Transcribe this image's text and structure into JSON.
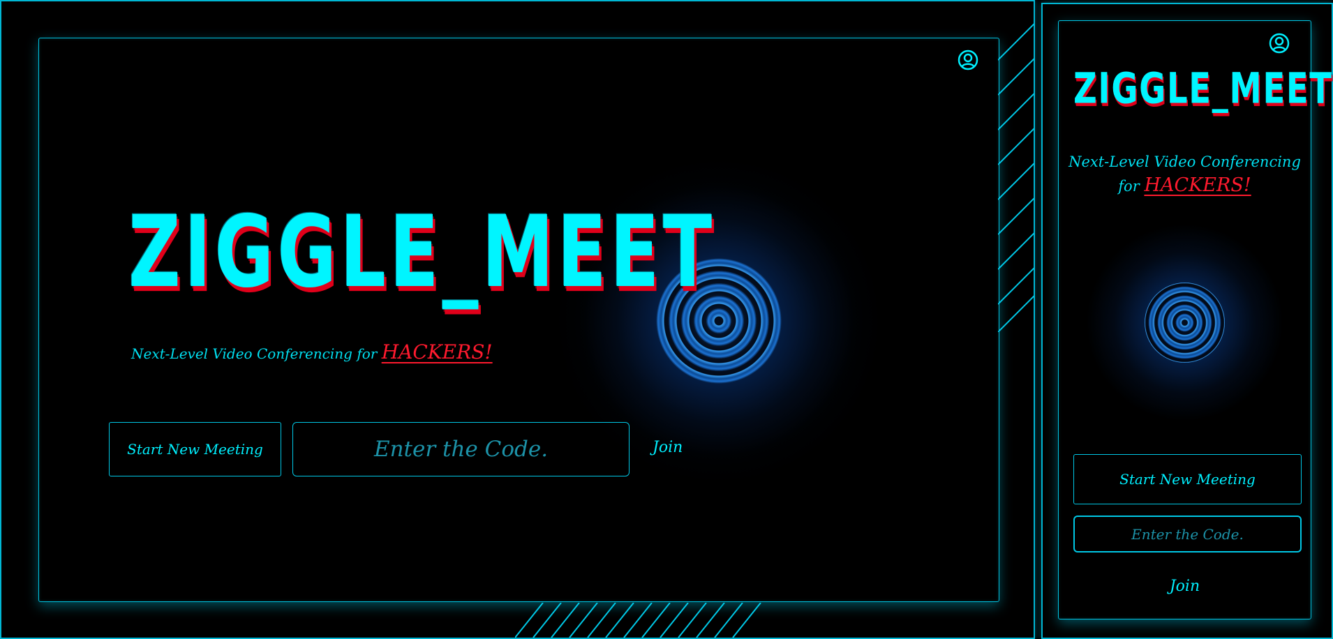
{
  "colors": {
    "accent": "#00f5ff",
    "border": "#00c8e6",
    "highlight": "#ff1a2e",
    "background": "#000000"
  },
  "desktop": {
    "logo": "ZIGGLE_MEET",
    "tagline_prefix": "Next-Level Video Conferencing for",
    "tagline_highlight": "HACKERS!",
    "start_button_label": "Start New Meeting",
    "code_placeholder": "Enter the Code.",
    "join_label": "Join",
    "user_icon": "user-circle-icon"
  },
  "mobile": {
    "logo": "ZIGGLE_MEET",
    "tagline_line1": "Next-Level Video Conferencing",
    "tagline_for": "for",
    "tagline_highlight": "HACKERS!",
    "start_button_label": "Start New Meeting",
    "code_placeholder": "Enter the Code.",
    "join_label": "Join",
    "user_icon": "user-circle-icon"
  }
}
